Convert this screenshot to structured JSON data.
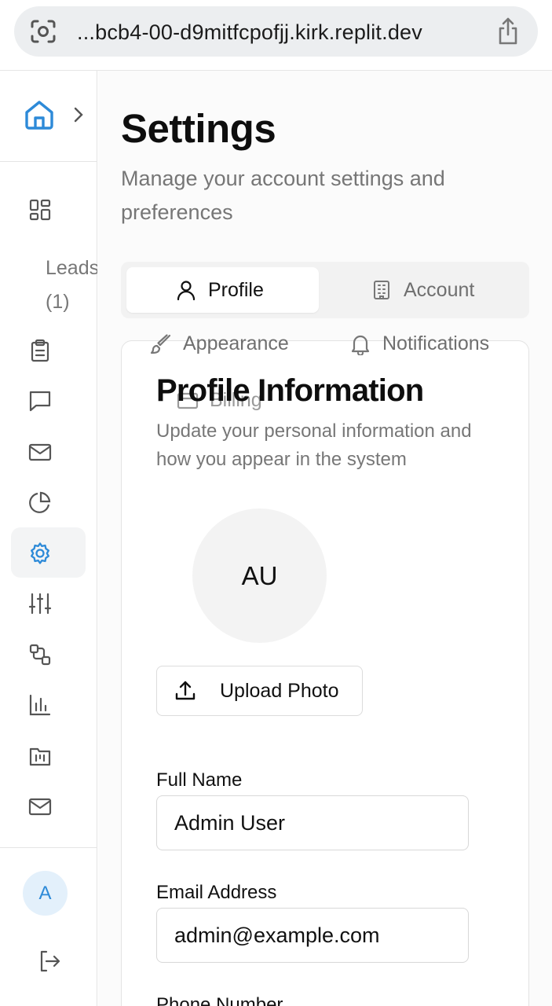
{
  "browser": {
    "url": "...bcb4-00-d9mitfcpofjj.kirk.replit.dev"
  },
  "sidebar": {
    "leads_label": "Leads",
    "leads_count": "(1)",
    "avatar_initial": "A",
    "active_item": "settings",
    "accent_color": "#2d8ad8"
  },
  "page": {
    "title": "Settings",
    "subtitle": "Manage your account settings and preferences"
  },
  "tabs": {
    "profile": "Profile",
    "account": "Account",
    "appearance": "Appearance",
    "notifications": "Notifications",
    "billing": "Billing",
    "active": "Profile"
  },
  "profile": {
    "title": "Profile Information",
    "description": "Update your personal information and how you appear in the system",
    "avatar_initials": "AU",
    "upload_label": "Upload Photo",
    "full_name_label": "Full Name",
    "full_name_value": "Admin User",
    "email_label": "Email Address",
    "email_value": "admin@example.com",
    "phone_label": "Phone Number"
  }
}
